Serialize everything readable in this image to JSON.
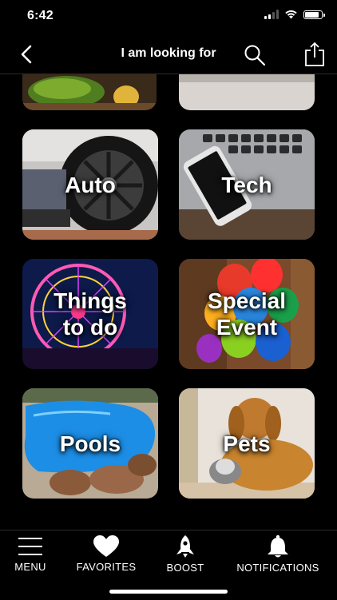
{
  "status_bar": {
    "time": "6:42",
    "battery_level": 0.92
  },
  "nav": {
    "title": "I am looking for",
    "back_icon": "chevron-left-icon",
    "search_icon": "search-icon",
    "share_icon": "share-icon"
  },
  "categories": [
    {
      "id": "auto",
      "label": "Auto"
    },
    {
      "id": "tech",
      "label": "Tech"
    },
    {
      "id": "things-to-do",
      "label_line1": "Things",
      "label_line2": "to do"
    },
    {
      "id": "special-event",
      "label_line1": "Special",
      "label_line2": "Event"
    },
    {
      "id": "pools",
      "label": "Pools"
    },
    {
      "id": "pets",
      "label": "Pets"
    }
  ],
  "tabs": [
    {
      "label": "MENU",
      "icon": "menu-icon"
    },
    {
      "label": "FAVORITES",
      "icon": "heart-icon"
    },
    {
      "label": "BOOST",
      "icon": "rocket-icon"
    },
    {
      "label": "NOTIFICATIONS",
      "icon": "bell-icon"
    }
  ]
}
